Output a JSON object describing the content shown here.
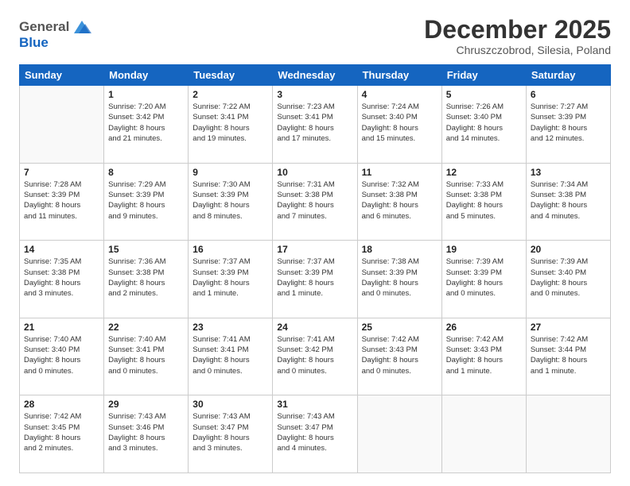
{
  "header": {
    "logo": {
      "line1": "General",
      "line2": "Blue"
    },
    "title": "December 2025",
    "subtitle": "Chruszczobrod, Silesia, Poland"
  },
  "weekdays": [
    "Sunday",
    "Monday",
    "Tuesday",
    "Wednesday",
    "Thursday",
    "Friday",
    "Saturday"
  ],
  "weeks": [
    [
      {
        "day": "",
        "info": ""
      },
      {
        "day": "1",
        "info": "Sunrise: 7:20 AM\nSunset: 3:42 PM\nDaylight: 8 hours\nand 21 minutes."
      },
      {
        "day": "2",
        "info": "Sunrise: 7:22 AM\nSunset: 3:41 PM\nDaylight: 8 hours\nand 19 minutes."
      },
      {
        "day": "3",
        "info": "Sunrise: 7:23 AM\nSunset: 3:41 PM\nDaylight: 8 hours\nand 17 minutes."
      },
      {
        "day": "4",
        "info": "Sunrise: 7:24 AM\nSunset: 3:40 PM\nDaylight: 8 hours\nand 15 minutes."
      },
      {
        "day": "5",
        "info": "Sunrise: 7:26 AM\nSunset: 3:40 PM\nDaylight: 8 hours\nand 14 minutes."
      },
      {
        "day": "6",
        "info": "Sunrise: 7:27 AM\nSunset: 3:39 PM\nDaylight: 8 hours\nand 12 minutes."
      }
    ],
    [
      {
        "day": "7",
        "info": "Sunrise: 7:28 AM\nSunset: 3:39 PM\nDaylight: 8 hours\nand 11 minutes."
      },
      {
        "day": "8",
        "info": "Sunrise: 7:29 AM\nSunset: 3:39 PM\nDaylight: 8 hours\nand 9 minutes."
      },
      {
        "day": "9",
        "info": "Sunrise: 7:30 AM\nSunset: 3:39 PM\nDaylight: 8 hours\nand 8 minutes."
      },
      {
        "day": "10",
        "info": "Sunrise: 7:31 AM\nSunset: 3:38 PM\nDaylight: 8 hours\nand 7 minutes."
      },
      {
        "day": "11",
        "info": "Sunrise: 7:32 AM\nSunset: 3:38 PM\nDaylight: 8 hours\nand 6 minutes."
      },
      {
        "day": "12",
        "info": "Sunrise: 7:33 AM\nSunset: 3:38 PM\nDaylight: 8 hours\nand 5 minutes."
      },
      {
        "day": "13",
        "info": "Sunrise: 7:34 AM\nSunset: 3:38 PM\nDaylight: 8 hours\nand 4 minutes."
      }
    ],
    [
      {
        "day": "14",
        "info": "Sunrise: 7:35 AM\nSunset: 3:38 PM\nDaylight: 8 hours\nand 3 minutes."
      },
      {
        "day": "15",
        "info": "Sunrise: 7:36 AM\nSunset: 3:38 PM\nDaylight: 8 hours\nand 2 minutes."
      },
      {
        "day": "16",
        "info": "Sunrise: 7:37 AM\nSunset: 3:39 PM\nDaylight: 8 hours\nand 1 minute."
      },
      {
        "day": "17",
        "info": "Sunrise: 7:37 AM\nSunset: 3:39 PM\nDaylight: 8 hours\nand 1 minute."
      },
      {
        "day": "18",
        "info": "Sunrise: 7:38 AM\nSunset: 3:39 PM\nDaylight: 8 hours\nand 0 minutes."
      },
      {
        "day": "19",
        "info": "Sunrise: 7:39 AM\nSunset: 3:39 PM\nDaylight: 8 hours\nand 0 minutes."
      },
      {
        "day": "20",
        "info": "Sunrise: 7:39 AM\nSunset: 3:40 PM\nDaylight: 8 hours\nand 0 minutes."
      }
    ],
    [
      {
        "day": "21",
        "info": "Sunrise: 7:40 AM\nSunset: 3:40 PM\nDaylight: 8 hours\nand 0 minutes."
      },
      {
        "day": "22",
        "info": "Sunrise: 7:40 AM\nSunset: 3:41 PM\nDaylight: 8 hours\nand 0 minutes."
      },
      {
        "day": "23",
        "info": "Sunrise: 7:41 AM\nSunset: 3:41 PM\nDaylight: 8 hours\nand 0 minutes."
      },
      {
        "day": "24",
        "info": "Sunrise: 7:41 AM\nSunset: 3:42 PM\nDaylight: 8 hours\nand 0 minutes."
      },
      {
        "day": "25",
        "info": "Sunrise: 7:42 AM\nSunset: 3:43 PM\nDaylight: 8 hours\nand 0 minutes."
      },
      {
        "day": "26",
        "info": "Sunrise: 7:42 AM\nSunset: 3:43 PM\nDaylight: 8 hours\nand 1 minute."
      },
      {
        "day": "27",
        "info": "Sunrise: 7:42 AM\nSunset: 3:44 PM\nDaylight: 8 hours\nand 1 minute."
      }
    ],
    [
      {
        "day": "28",
        "info": "Sunrise: 7:42 AM\nSunset: 3:45 PM\nDaylight: 8 hours\nand 2 minutes."
      },
      {
        "day": "29",
        "info": "Sunrise: 7:43 AM\nSunset: 3:46 PM\nDaylight: 8 hours\nand 3 minutes."
      },
      {
        "day": "30",
        "info": "Sunrise: 7:43 AM\nSunset: 3:47 PM\nDaylight: 8 hours\nand 3 minutes."
      },
      {
        "day": "31",
        "info": "Sunrise: 7:43 AM\nSunset: 3:47 PM\nDaylight: 8 hours\nand 4 minutes."
      },
      {
        "day": "",
        "info": ""
      },
      {
        "day": "",
        "info": ""
      },
      {
        "day": "",
        "info": ""
      }
    ]
  ]
}
